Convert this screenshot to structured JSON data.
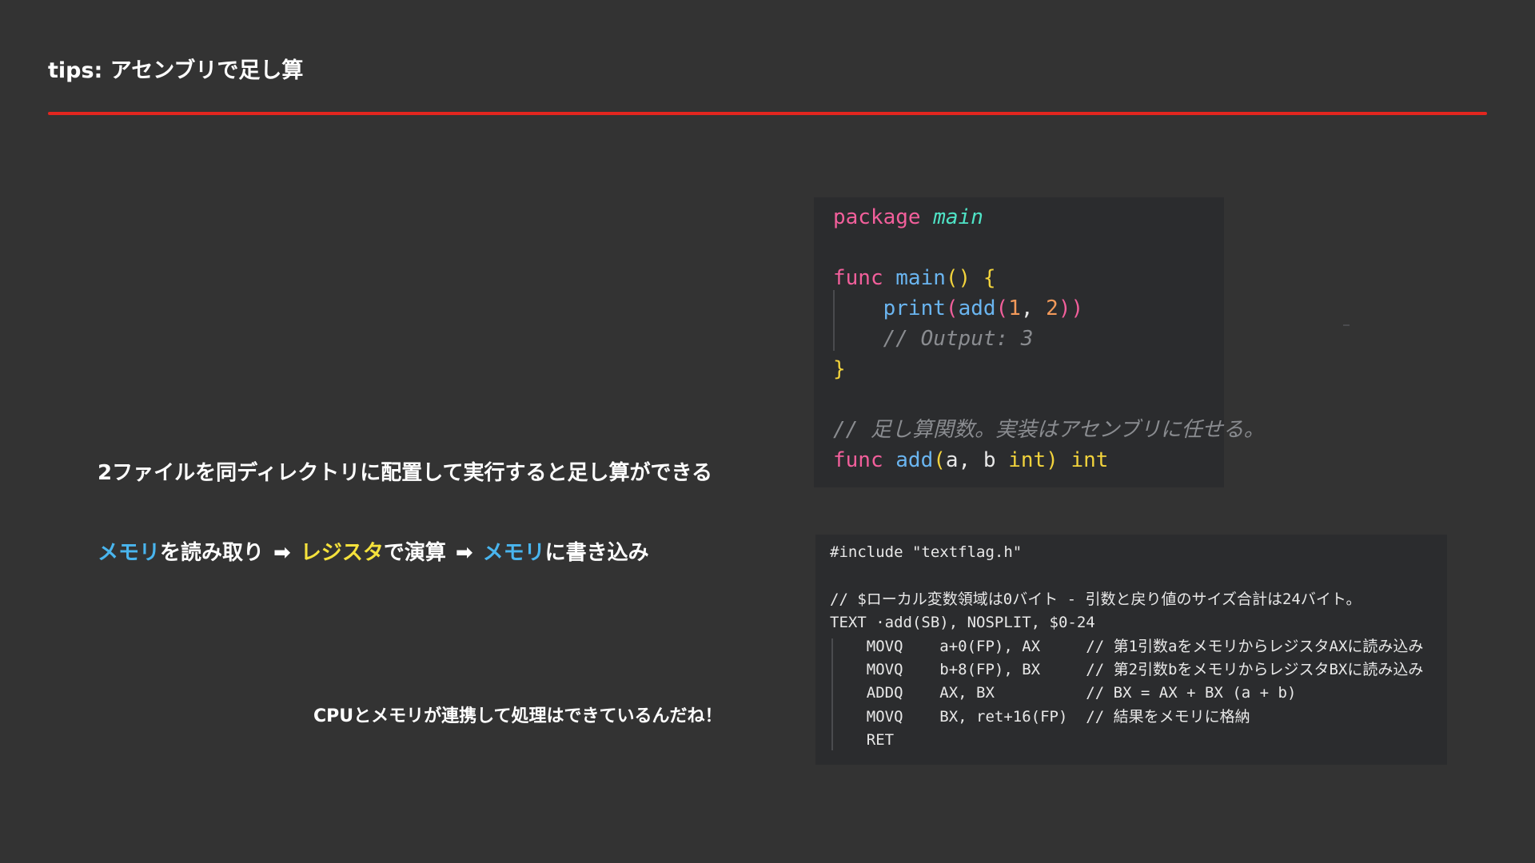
{
  "slide": {
    "title": "tips: アセンブリで足し算",
    "rule_color": "#e3261f",
    "background": "#333333"
  },
  "points": {
    "line1": "2ファイルを同ディレクトリに配置して実行すると足し算ができる",
    "line2": {
      "part1": "メモリ",
      "part2": "を読み取り",
      "arrow1": "➡",
      "part3": "レジスタ",
      "part4": "で演算",
      "arrow2": "➡",
      "part5": "メモリ",
      "part6": "に書き込み"
    },
    "line3": "CPUとメモリが連携して処理はできているんだね！"
  },
  "go_code": {
    "lines": [
      [
        {
          "t": "package ",
          "c": "kw"
        },
        {
          "t": "main",
          "c": "pkg"
        }
      ],
      [],
      [
        {
          "t": "func ",
          "c": "kw"
        },
        {
          "t": "main",
          "c": "fn"
        },
        {
          "t": "() {",
          "c": "paren"
        }
      ],
      [
        {
          "t": "    ",
          "c": "pl"
        },
        {
          "t": "print",
          "c": "fn"
        },
        {
          "t": "(",
          "c": "kw"
        },
        {
          "t": "add",
          "c": "fn"
        },
        {
          "t": "(",
          "c": "kw"
        },
        {
          "t": "1",
          "c": "num"
        },
        {
          "t": ", ",
          "c": "pl"
        },
        {
          "t": "2",
          "c": "num"
        },
        {
          "t": "))",
          "c": "kw"
        }
      ],
      [
        {
          "t": "    ",
          "c": "pl"
        },
        {
          "t": "// Output: 3",
          "c": "cm"
        }
      ],
      [
        {
          "t": "}",
          "c": "paren"
        }
      ],
      [],
      [
        {
          "t": "// 足し算関数。実装はアセンブリに任せる。",
          "c": "cm"
        }
      ],
      [
        {
          "t": "func ",
          "c": "kw"
        },
        {
          "t": "add",
          "c": "fn"
        },
        {
          "t": "(",
          "c": "paren"
        },
        {
          "t": "a, b ",
          "c": "pl"
        },
        {
          "t": "int",
          "c": "ty"
        },
        {
          "t": ") ",
          "c": "paren"
        },
        {
          "t": "int",
          "c": "ty"
        }
      ]
    ],
    "colors": {
      "keyword": "#f25f9b",
      "package": "#4fe3c6",
      "function": "#6ab5f0",
      "paren": "#f2d33c",
      "number": "#f39a5a",
      "comment": "#8a8c90"
    }
  },
  "asm_code": {
    "lines": [
      "#include \"textflag.h\"",
      "",
      "// $ローカル変数領域は0バイト - 引数と戻り値のサイズ合計は24バイト。",
      "TEXT ·add(SB), NOSPLIT, $0-24",
      "    MOVQ    a+0(FP), AX     // 第1引数aをメモリからレジスタAXに読み込み",
      "    MOVQ    b+8(FP), BX     // 第2引数bをメモリからレジスタBXに読み込み",
      "    ADDQ    AX, BX          // BX = AX + BX (a + b)",
      "    MOVQ    BX, ret+16(FP)  // 結果をメモリに格納",
      "    RET"
    ]
  }
}
